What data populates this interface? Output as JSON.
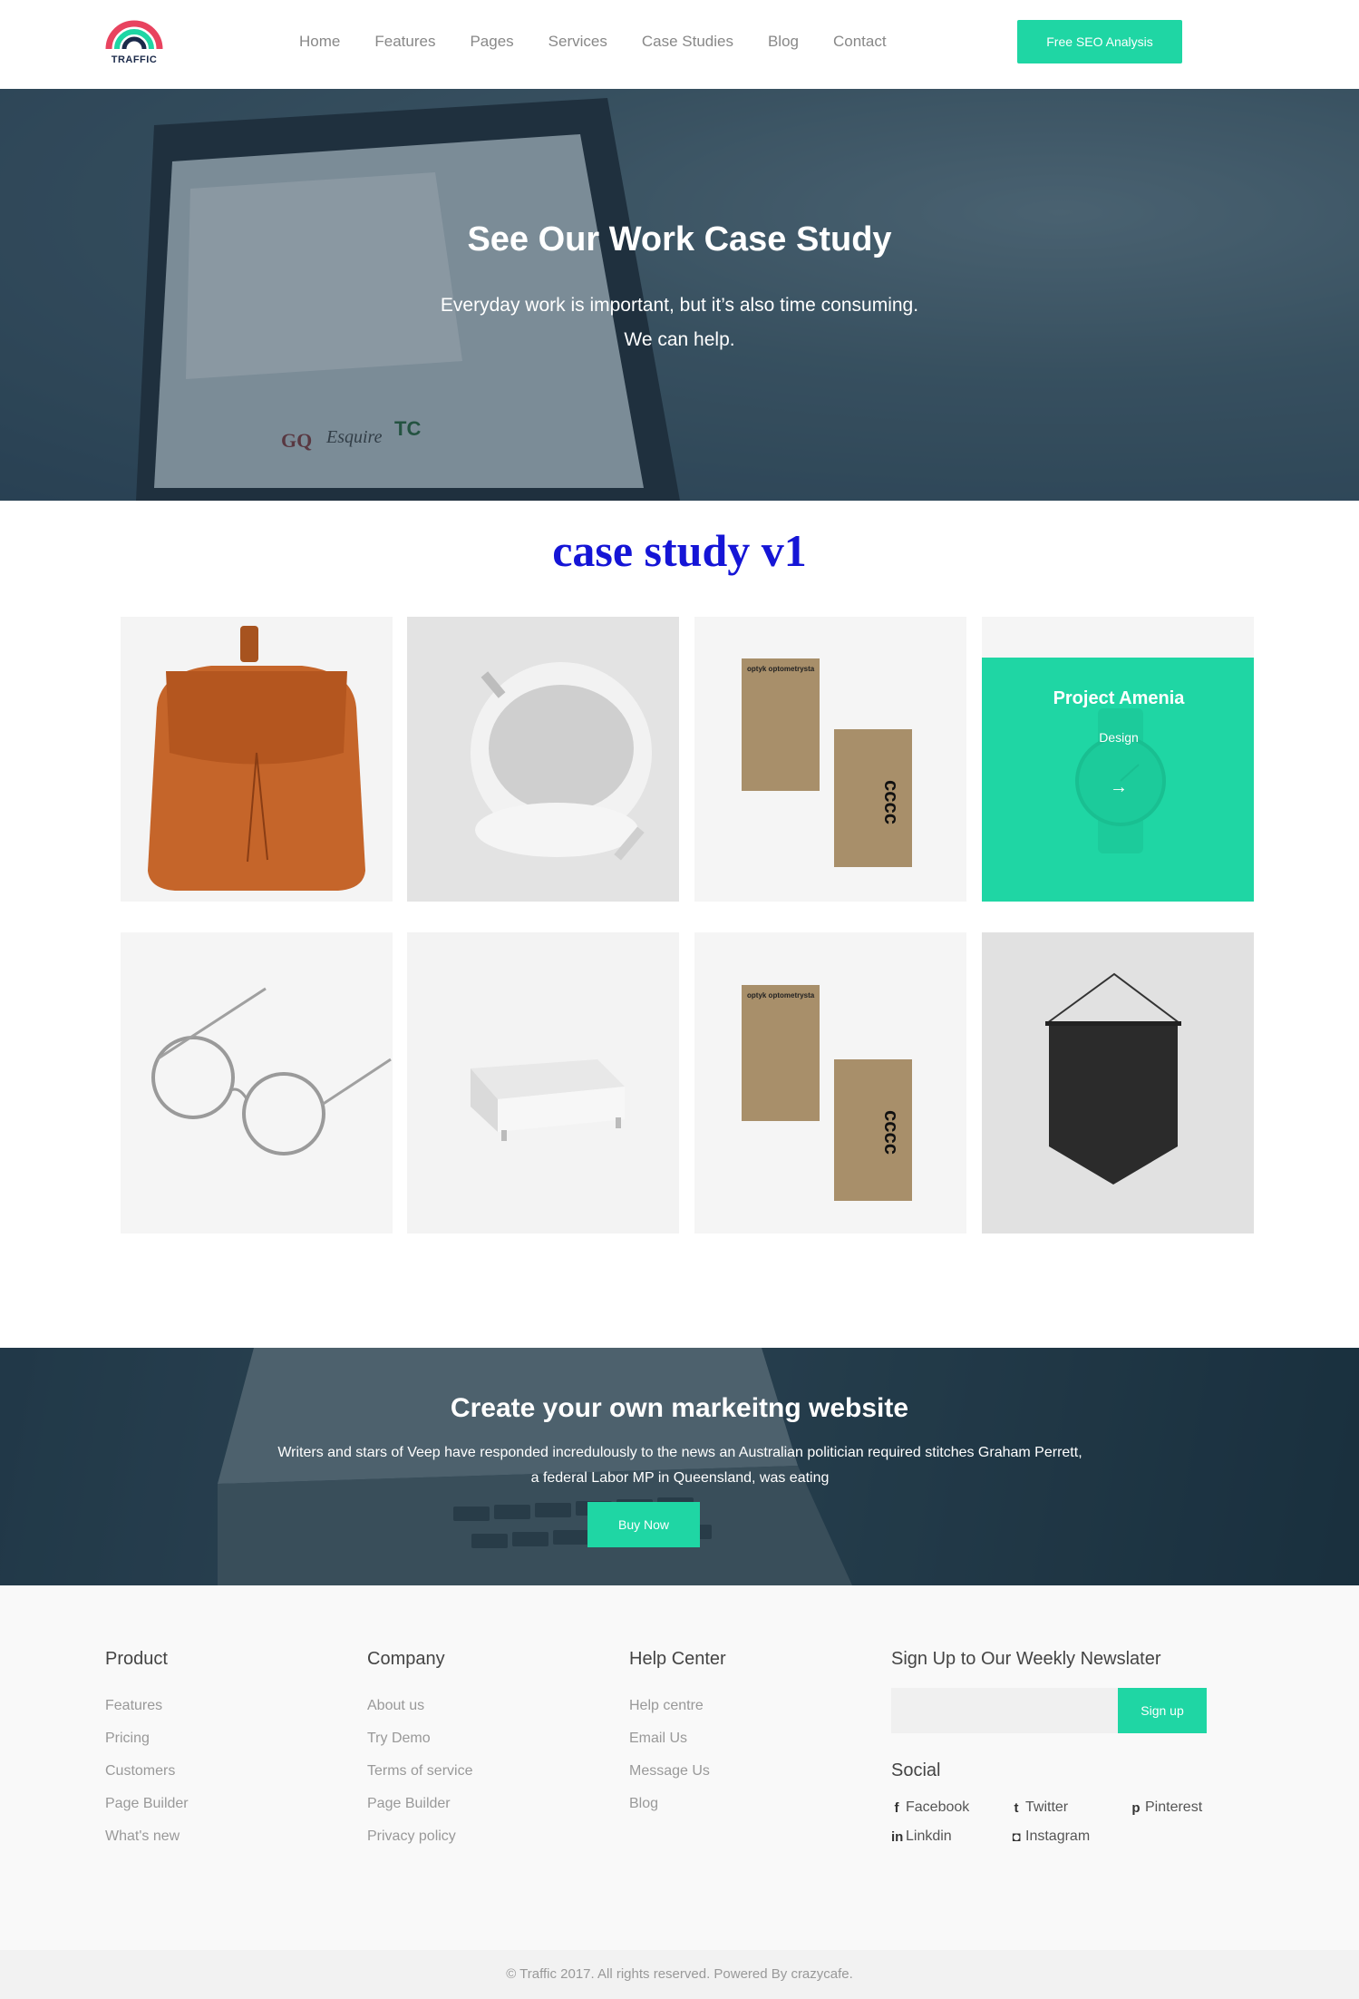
{
  "header": {
    "logo_text": "TRAFFIC",
    "nav": [
      "Home",
      "Features",
      "Pages",
      "Services",
      "Case Studies",
      "Blog",
      "Contact"
    ],
    "cta_label": "Free SEO Analysis"
  },
  "hero": {
    "title": "See Our Work Case Study",
    "subtitle_line1": "Everyday work is important, but it’s also time consuming.",
    "subtitle_line2": "We can help."
  },
  "case_study": {
    "heading": "case study v1",
    "featured": {
      "title": "Project Amenia",
      "category": "Design",
      "arrow": "→"
    },
    "card_logos": [
      "optyk optometrysta",
      "cccc"
    ]
  },
  "banner": {
    "title": "Create your own markeitng website",
    "text": "Writers and stars of Veep have responded incredulously to the news an Australian politician required stitches Graham Perrett, a federal Labor MP in Queensland, was eating",
    "button": "Buy Now"
  },
  "footer": {
    "columns": [
      {
        "title": "Product",
        "links": [
          "Features",
          "Pricing",
          "Customers",
          "Page Builder",
          "What's new"
        ]
      },
      {
        "title": "Company",
        "links": [
          "About us",
          "Try Demo",
          "Terms of service",
          "Page Builder",
          "Privacy policy"
        ]
      },
      {
        "title": "Help Center",
        "links": [
          "Help centre",
          "Email Us",
          "Message Us",
          "Blog"
        ]
      }
    ],
    "newsletter": {
      "title": "Sign Up to Our Weekly Newslater",
      "placeholder": "",
      "button": "Sign up"
    },
    "social": {
      "title": "Social",
      "items": [
        {
          "icon": "facebook-icon",
          "glyph": "f",
          "label": "Facebook"
        },
        {
          "icon": "twitter-icon",
          "glyph": "t",
          "label": "Twitter"
        },
        {
          "icon": "pinterest-icon",
          "glyph": "p",
          "label": "Pinterest"
        },
        {
          "icon": "linkedin-icon",
          "glyph": "in",
          "label": "Linkdin"
        },
        {
          "icon": "instagram-icon",
          "glyph": "◘",
          "label": "Instagram"
        }
      ]
    },
    "copyright": "© Traffic 2017. All rights reserved. Powered By crazycafe."
  },
  "colors": {
    "accent": "#1fd6a4",
    "heading_blue": "#1515d6",
    "logo_red": "#e8435f",
    "logo_teal": "#1fd6a4",
    "logo_navy": "#1b2a4a"
  }
}
